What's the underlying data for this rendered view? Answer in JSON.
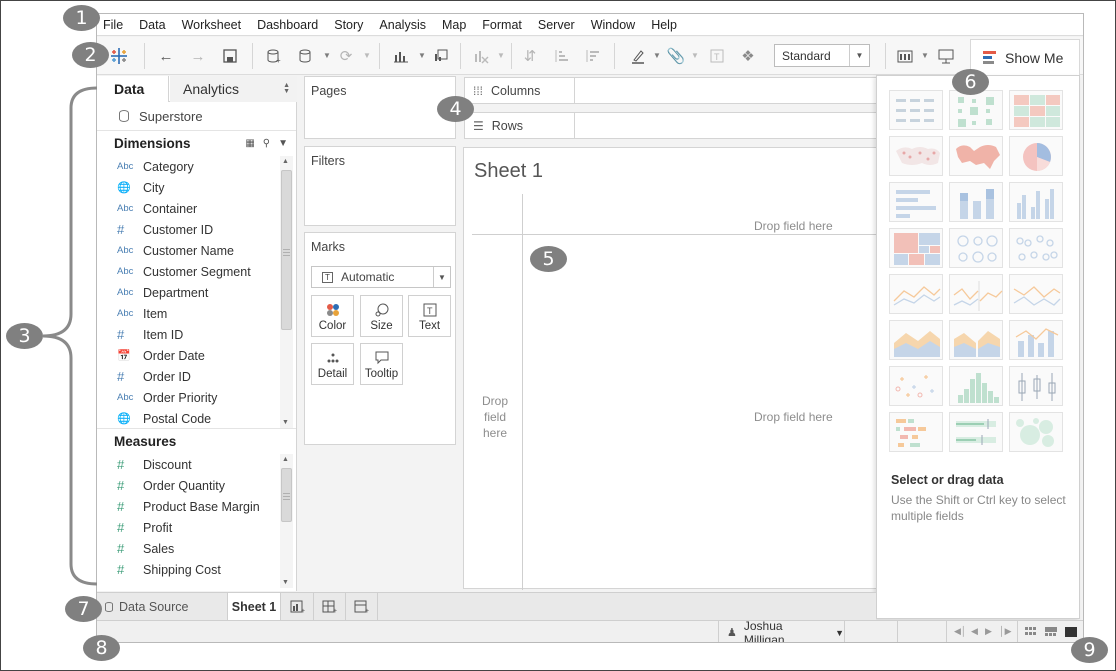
{
  "menu": [
    "File",
    "Data",
    "Worksheet",
    "Dashboard",
    "Story",
    "Analysis",
    "Map",
    "Format",
    "Server",
    "Window",
    "Help"
  ],
  "toolbar": {
    "fit_value": "Standard",
    "show_me_label": "Show Me",
    "colors": {
      "brand_red": "#e35b48",
      "brand_blue": "#2d6db4",
      "brand_gray": "#8a8a8a"
    }
  },
  "data_pane": {
    "tab_data": "Data",
    "tab_analytics": "Analytics",
    "datasource": "Superstore",
    "dimensions_title": "Dimensions",
    "dimensions": [
      {
        "type": "Abc",
        "name": "Category"
      },
      {
        "type": "geo",
        "name": "City"
      },
      {
        "type": "Abc",
        "name": "Container"
      },
      {
        "type": "#",
        "name": "Customer ID"
      },
      {
        "type": "Abc",
        "name": "Customer Name"
      },
      {
        "type": "Abc",
        "name": "Customer Segment"
      },
      {
        "type": "Abc",
        "name": "Department"
      },
      {
        "type": "Abc",
        "name": "Item"
      },
      {
        "type": "#",
        "name": "Item ID"
      },
      {
        "type": "date",
        "name": "Order Date"
      },
      {
        "type": "#",
        "name": "Order ID"
      },
      {
        "type": "Abc",
        "name": "Order Priority"
      },
      {
        "type": "geo",
        "name": "Postal Code"
      }
    ],
    "measures_title": "Measures",
    "measures": [
      {
        "type": "#",
        "name": "Discount"
      },
      {
        "type": "#",
        "name": "Order Quantity"
      },
      {
        "type": "#",
        "name": "Product Base Margin"
      },
      {
        "type": "#",
        "name": "Profit"
      },
      {
        "type": "#",
        "name": "Sales"
      },
      {
        "type": "#",
        "name": "Shipping Cost"
      }
    ]
  },
  "cards": {
    "pages": "Pages",
    "filters": "Filters",
    "marks": "Marks",
    "mark_type": "Automatic",
    "mark_buttons": [
      "Color",
      "Size",
      "Text",
      "Detail",
      "Tooltip"
    ]
  },
  "shelves": {
    "columns": "Columns",
    "rows": "Rows"
  },
  "view": {
    "sheet_title": "Sheet 1",
    "drop_top": "Drop field here",
    "drop_center": "Drop field here",
    "drop_left": "Drop field here"
  },
  "show_me": {
    "hint_title": "Select or drag data",
    "hint_text": "Use the Shift or Ctrl key to select multiple fields"
  },
  "tabs": {
    "datasource": "Data Source",
    "sheet": "Sheet 1"
  },
  "status": {
    "user": "Joshua Milligan"
  },
  "callouts": [
    "1",
    "2",
    "3",
    "4",
    "5",
    "6",
    "7",
    "8",
    "9"
  ]
}
